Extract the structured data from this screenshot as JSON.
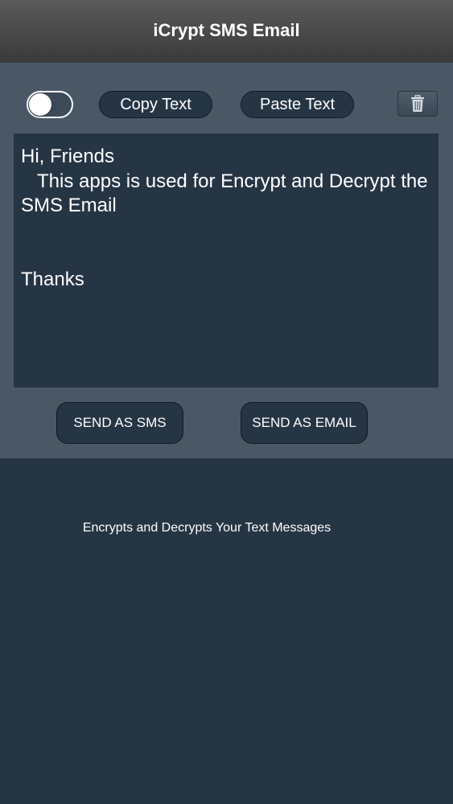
{
  "nav": {
    "title": "iCrypt SMS Email"
  },
  "toolbar": {
    "toggle_on": false,
    "copy_label": "Copy Text",
    "paste_label": "Paste Text",
    "trash_icon": "trash-icon"
  },
  "editor": {
    "text": "Hi, Friends\n   This apps is used for Encrypt and Decrypt the SMS Email\n\n\nThanks"
  },
  "actions": {
    "sms_label": "SEND AS SMS",
    "email_label": "SEND AS EMAIL"
  },
  "footer": {
    "tagline": "Encrypts and Decrypts Your Text Messages"
  },
  "colors": {
    "background": "#263544",
    "panel": "#4a5866",
    "navbar": "#3a3a3a"
  }
}
